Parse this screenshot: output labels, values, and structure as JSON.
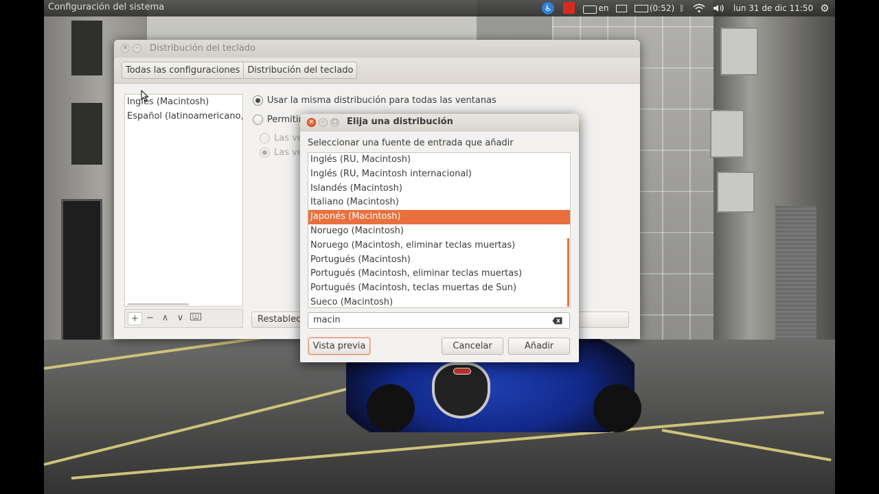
{
  "top_panel": {
    "app_title": "Configuración del sistema",
    "keyboard_lang": "en",
    "battery": "(0:52)",
    "datetime": "lun 31 de dic  11:50"
  },
  "main_window": {
    "title": "Distribución del teclado",
    "breadcrumbs": [
      "Todas las configuraciones",
      "Distribución del teclado"
    ],
    "input_sources": [
      "Inglés (Macintosh)",
      "Español (latinoamericano, el"
    ],
    "toolbar": {
      "add": "+",
      "remove": "−",
      "up": "∧",
      "down": "∨"
    },
    "options": {
      "same_layout": "Usar la misma distribución para todas las ventanas",
      "different_layout": "Permitir",
      "sub_option_1": "Las ve",
      "sub_option_2": "Las ve"
    },
    "reset_label": "Restablece"
  },
  "dialog": {
    "title": "Elija una distribución",
    "caption": "Seleccionar una fuente de entrada que añadir",
    "layouts": [
      "Inglés (RU, Macintosh)",
      "Inglés (RU, Macintosh internacional)",
      "Islandés (Macintosh)",
      "Italiano (Macintosh)",
      "Japonés (Macintosh)",
      "Noruego (Macintosh)",
      "Noruego (Macintosh, eliminar teclas muertas)",
      "Portugués (Macintosh)",
      "Portugués (Macintosh, eliminar teclas muertas)",
      "Portugués (Macintosh, teclas muertas de Sun)",
      "Sueco (Macintosh)"
    ],
    "selected_index": 4,
    "search_value": "macin",
    "buttons": {
      "preview": "Vista previa",
      "cancel": "Cancelar",
      "add": "Añadir"
    }
  },
  "colors": {
    "accent": "#e9703d",
    "panel": "#3c3b37"
  }
}
